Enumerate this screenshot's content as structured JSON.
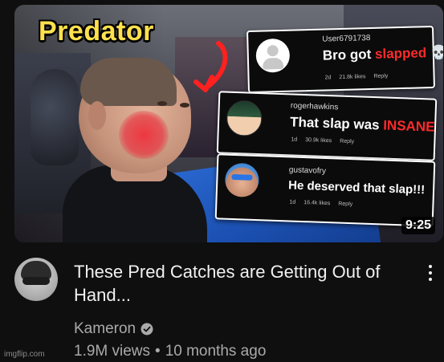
{
  "thumbnail": {
    "overlay_label": "Predator",
    "duration": "9:25",
    "comments": [
      {
        "user": "User6791738",
        "text_plain": "Bro got ",
        "text_highlight": "slapped",
        "text_suffix": " 💀",
        "age": "2d",
        "likes": "21.8k likes",
        "reply": "Reply",
        "avatar": "default-avatar"
      },
      {
        "user": "rogerhawkins",
        "text_plain": "That slap was ",
        "text_highlight": "INSANE",
        "text_suffix": "",
        "age": "1d",
        "likes": "30.9k likes",
        "reply": "Reply",
        "avatar": "anime-avatar"
      },
      {
        "user": "gustavofry",
        "text_plain": "He deserved that slap!!!",
        "text_highlight": "",
        "text_suffix": "",
        "age": "1d",
        "likes": "16.4k likes",
        "reply": "Reply",
        "avatar": "sunglasses-avatar"
      }
    ]
  },
  "video": {
    "title": "These Pred Catches are Getting Out of Hand...",
    "channel": "Kameron",
    "views": "1.9M views",
    "separator": "•",
    "age": "10 months ago"
  },
  "icons": {
    "verified": "verified-check-icon",
    "more": "more-vert-icon"
  },
  "watermark": "imgflip.com",
  "colors": {
    "background": "#0f0f0f",
    "label_yellow": "#ffe14d",
    "highlight_red": "#ff2a2a",
    "secondary_text": "#aaaaaa"
  }
}
